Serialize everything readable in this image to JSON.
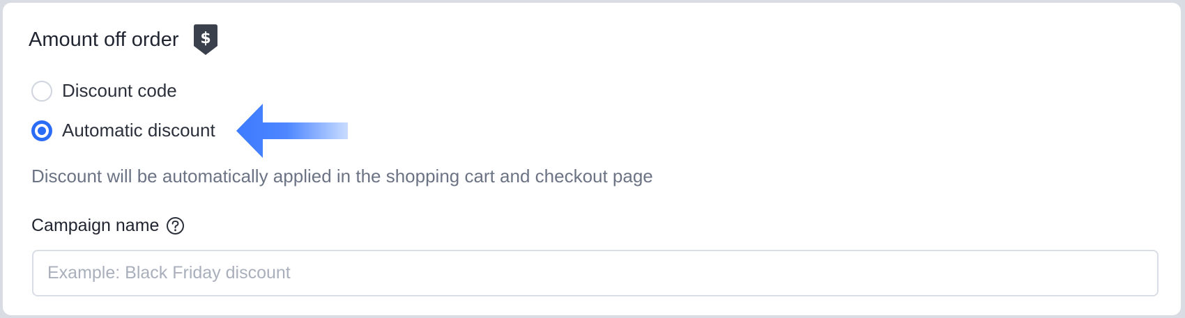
{
  "section": {
    "title": "Amount off order",
    "title_icon": "dollar-tag-icon"
  },
  "discount_type": {
    "options": [
      {
        "label": "Discount code",
        "selected": false
      },
      {
        "label": "Automatic discount",
        "selected": true
      }
    ],
    "help_text": "Discount will be automatically applied in the shopping cart and checkout page"
  },
  "campaign": {
    "label": "Campaign name",
    "help_icon": "question-circle-icon",
    "value": "",
    "placeholder": "Example: Black Friday discount"
  },
  "colors": {
    "accent": "#2b6cf6",
    "icon_dark": "#3a404c",
    "arrow": "#3d7bff"
  }
}
